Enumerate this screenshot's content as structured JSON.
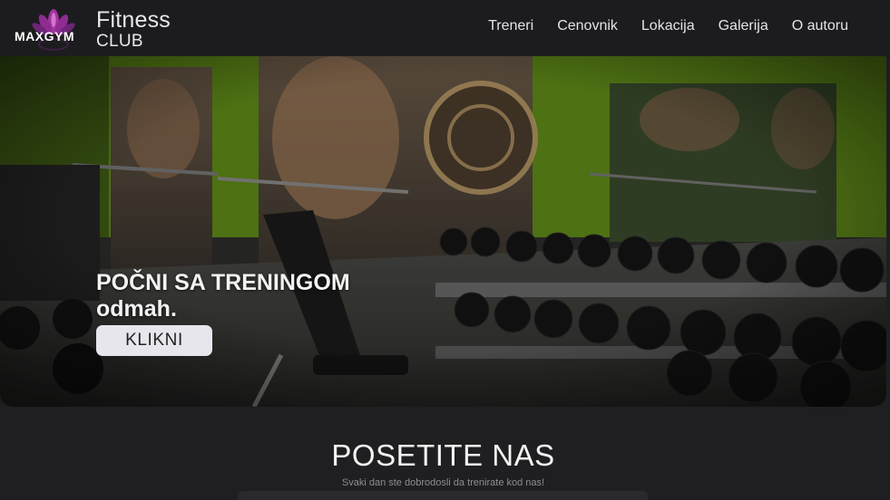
{
  "navbar": {
    "logo_text": "MAXGYM",
    "brand_line1": "Fitness",
    "brand_line2": "CLUB",
    "links": [
      {
        "label": "Treneri"
      },
      {
        "label": "Cenovnik"
      },
      {
        "label": "Lokacija"
      },
      {
        "label": "Galerija"
      },
      {
        "label": "O autoru"
      }
    ]
  },
  "hero": {
    "headline_line1": "POČNI SA TRENINGOM",
    "headline_line2": "odmah.",
    "cta_label": "KLIKNI",
    "image": "gym-interior-photo"
  },
  "section": {
    "title": "POSETITE NAS",
    "subtitle": "Svaki dan ste dobrodosli da trenirate kod nas!"
  },
  "colors": {
    "navbar_bg": "#1c1c1e",
    "page_bg": "#1f1f21",
    "wall_green": "#6f9a1c",
    "button_bg": "#e6e6ec",
    "logo_purple": "#b03aa8"
  }
}
